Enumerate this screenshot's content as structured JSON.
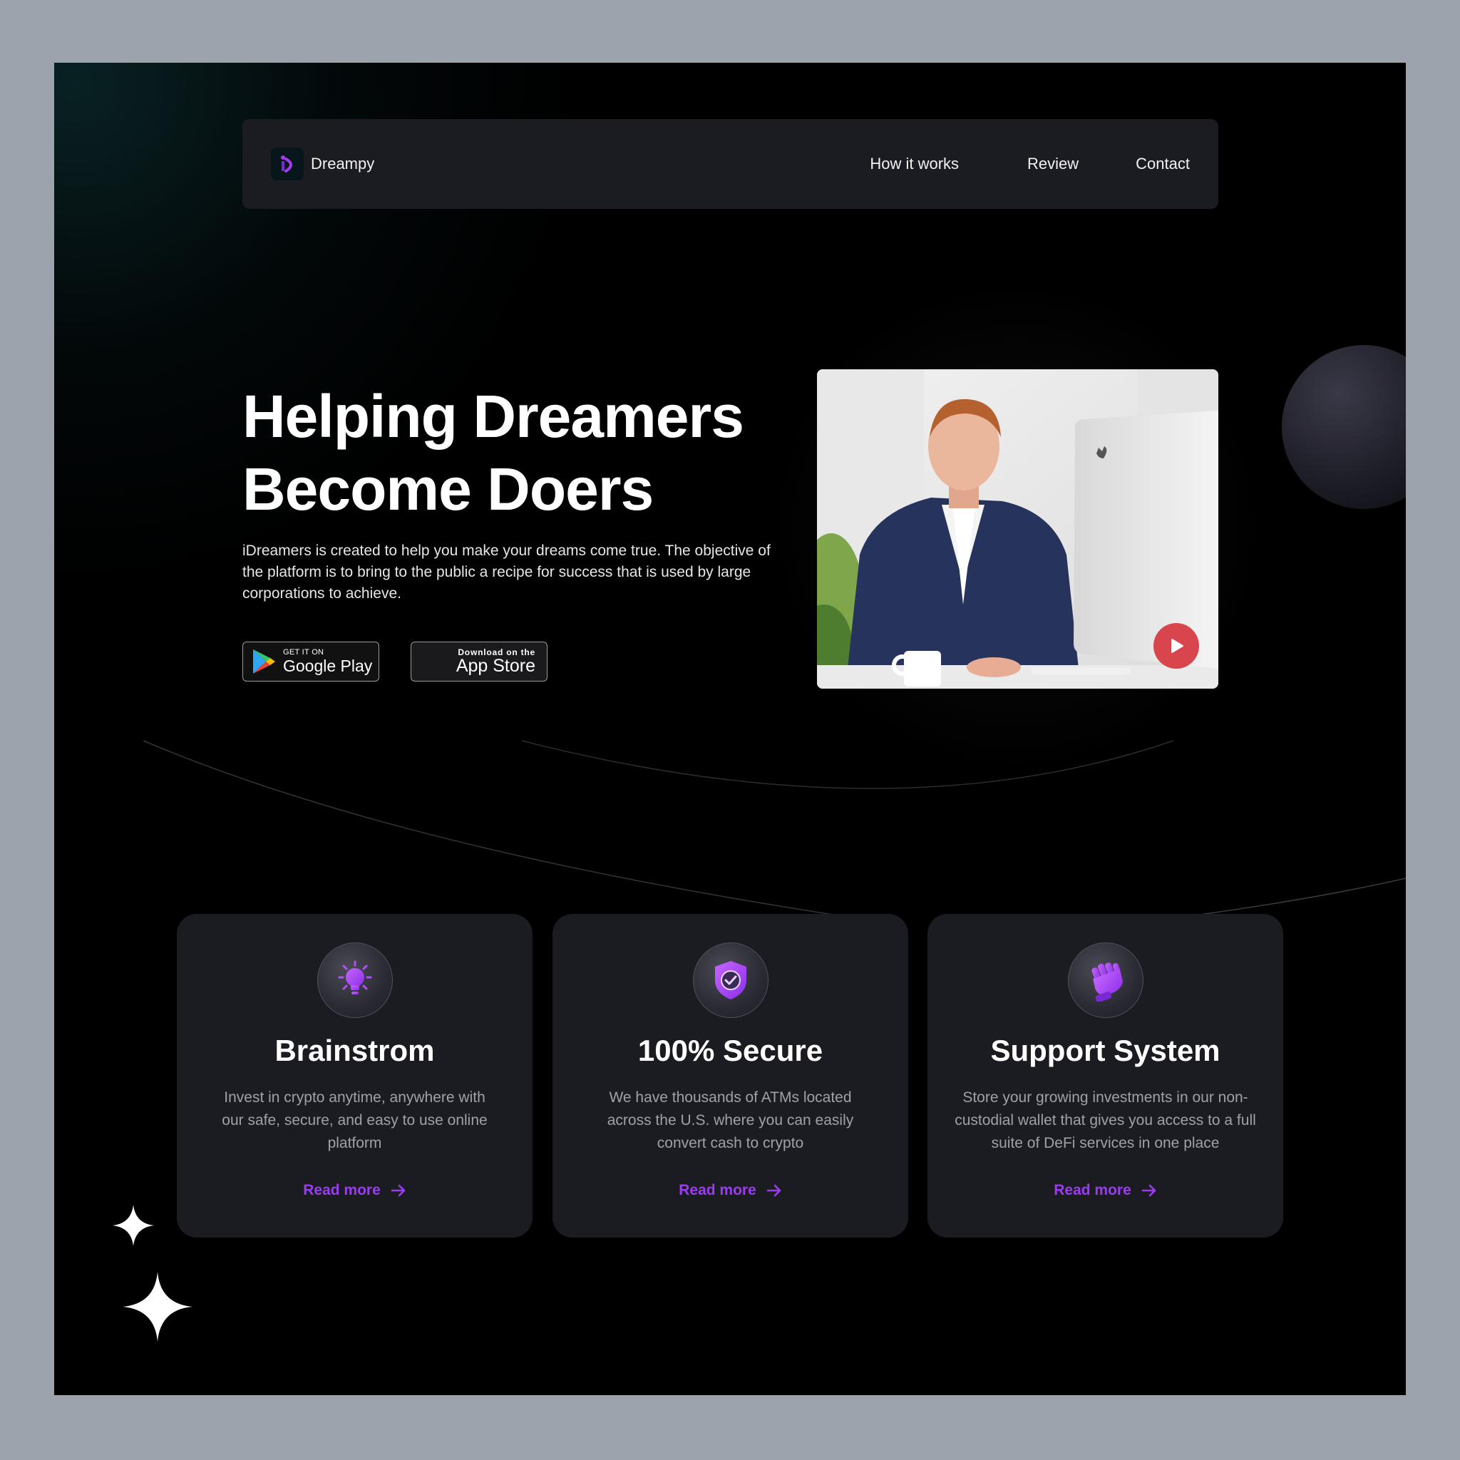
{
  "nav": {
    "brand": "Dreampy",
    "links": [
      "How it works",
      "Review",
      "Contact"
    ]
  },
  "hero": {
    "title_line1": "Helping Dreamers",
    "title_line2": "Become Doers",
    "description": "iDreamers is created to help you make your dreams come true. The objective of the platform is to bring to the public a recipe for success that is used by large corporations to achieve."
  },
  "stores": {
    "google": {
      "small": "GET IT ON",
      "big": "Google Play"
    },
    "apple": {
      "small": "Download on the",
      "big": "App Store"
    }
  },
  "features": [
    {
      "icon": "lightbulb-icon",
      "title": "Brainstrom",
      "description": "Invest in crypto anytime, anywhere with our safe, secure, and easy to use online platform",
      "link": "Read more"
    },
    {
      "icon": "shield-check-icon",
      "title": "100% Secure",
      "description": "We have thousands of ATMs located across the U.S. where you can easily convert cash to crypto",
      "link": "Read more"
    },
    {
      "icon": "fist-icon",
      "title": "Support System",
      "description": "Store your growing investments in our non-custodial wallet that gives you access to a full suite of DeFi services in one place",
      "link": "Read more"
    }
  ],
  "colors": {
    "background": "#000000",
    "card": "#1b1b22",
    "accent": "#9b3cf0",
    "play": "#d9454c"
  }
}
